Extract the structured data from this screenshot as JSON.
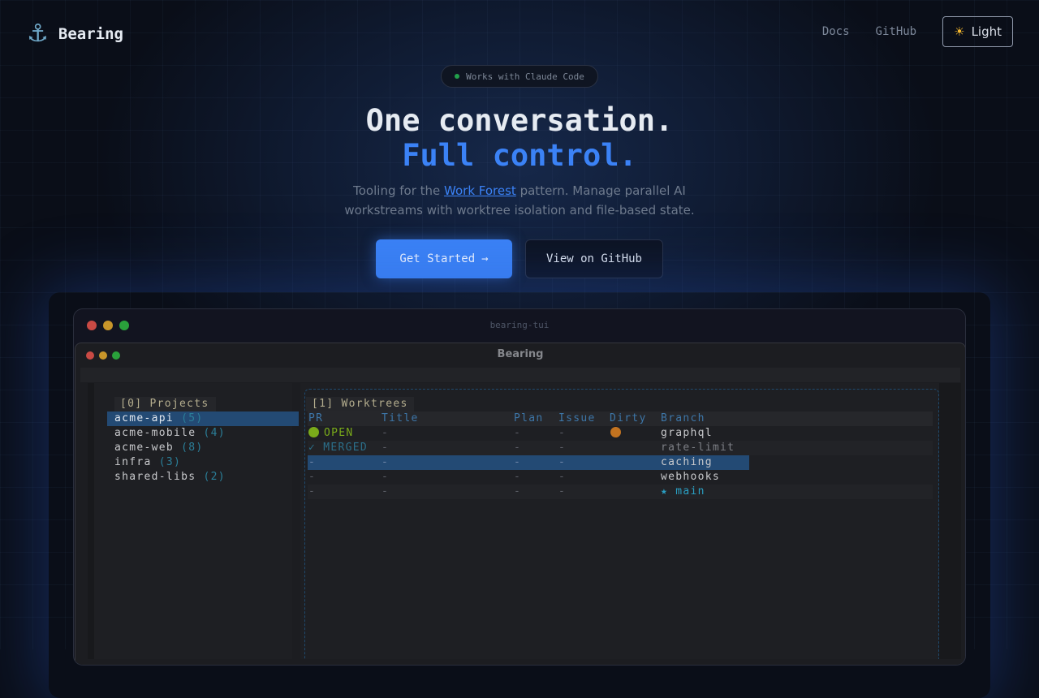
{
  "nav": {
    "brand": "Bearing",
    "links": [
      "Docs",
      "GitHub"
    ],
    "theme_button": "Light"
  },
  "hero": {
    "badge": "Works with Claude Code",
    "title_line1": "One conversation.",
    "title_line2": "Full control.",
    "subtitle_pre": "Tooling for the ",
    "subtitle_link": "Work Forest",
    "subtitle_post": " pattern. Manage parallel AI",
    "subtitle_line2": "workstreams with worktree isolation and file-based state.",
    "primary_button": "Get Started",
    "secondary_button": "View on GitHub"
  },
  "terminal": {
    "window_title": "bearing-tui",
    "app_title": "Bearing",
    "projects": {
      "title": "[0] Projects",
      "items": [
        {
          "name": "acme-api",
          "count": "(5)"
        },
        {
          "name": "acme-mobile",
          "count": "(4)"
        },
        {
          "name": "acme-web",
          "count": "(8)"
        },
        {
          "name": "infra",
          "count": "(3)"
        },
        {
          "name": "shared-libs",
          "count": "(2)"
        }
      ]
    },
    "worktrees": {
      "title": "[1] Worktrees",
      "columns": [
        "PR",
        "Title",
        "Plan",
        "Issue",
        "Dirty",
        "Branch"
      ],
      "rows": [
        {
          "pr": "OPEN",
          "title": "-",
          "plan": "-",
          "issue": "-",
          "dirty": "yes",
          "branch": "graphql"
        },
        {
          "pr": "MERGED",
          "title": "-",
          "plan": "-",
          "issue": "-",
          "dirty": "",
          "branch": "rate-limit"
        },
        {
          "pr": "-",
          "title": "-",
          "plan": "-",
          "issue": "-",
          "dirty": "",
          "branch": "caching"
        },
        {
          "pr": "-",
          "title": "-",
          "plan": "-",
          "issue": "-",
          "dirty": "",
          "branch": "webhooks"
        },
        {
          "pr": "-",
          "title": "-",
          "plan": "-",
          "issue": "-",
          "dirty": "",
          "branch": "main"
        }
      ]
    }
  },
  "colors": {
    "accent": "#3b82f6",
    "open": "#7aab1a",
    "dirty": "#c27320",
    "selection": "#234a74"
  }
}
